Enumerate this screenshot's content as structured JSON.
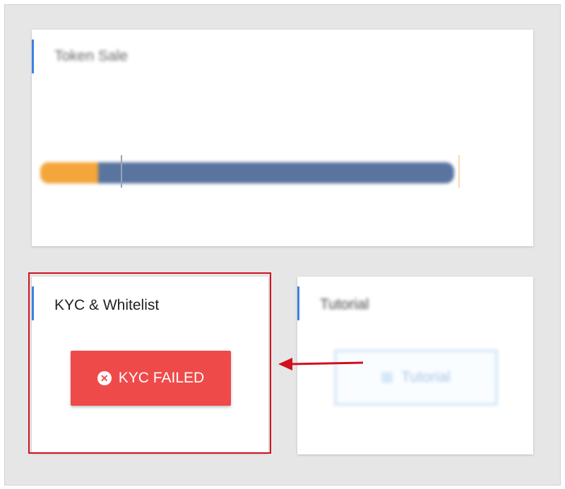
{
  "token_sale": {
    "title": "Token Sale",
    "current_marker": [
      "",
      ""
    ],
    "start_marker": [
      "",
      ""
    ],
    "end_marker": [
      "",
      ""
    ],
    "progress": 0.14
  },
  "kyc": {
    "title": "KYC & Whitelist",
    "button_label": "KYC FAILED",
    "status_icon": "x-circle-icon"
  },
  "tutorial": {
    "title": "Tutorial",
    "button_label": "Tutorial"
  },
  "colors": {
    "accent": "#3d82e0",
    "progress_fill": "#f4a63a",
    "progress_track": "#5a74a0",
    "error": "#ef4a4a",
    "highlight": "#d0101e"
  }
}
